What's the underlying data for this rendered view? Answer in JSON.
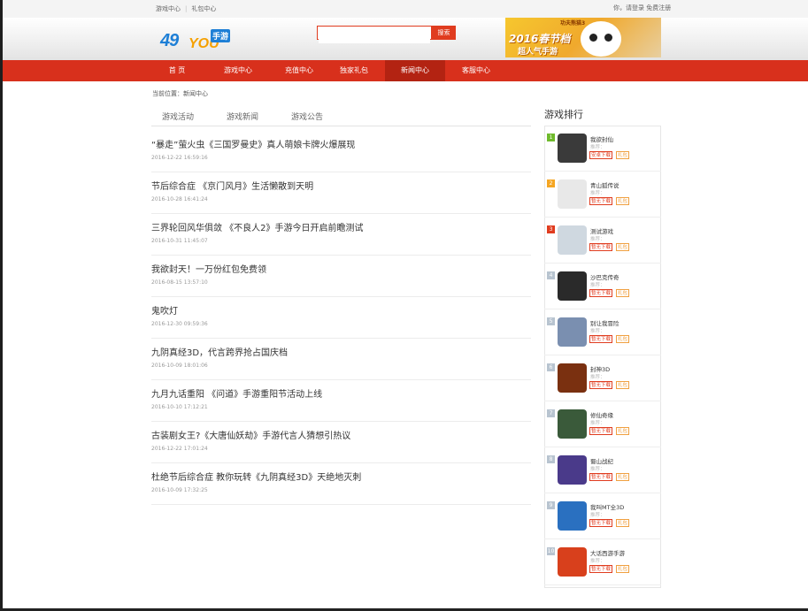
{
  "topbar": {
    "links": [
      "游戏中心",
      "礼包中心"
    ],
    "login_text": "你，请登录 免费注册"
  },
  "header": {
    "logo_num": "49",
    "logo_you": "YOU",
    "logo_tag": "手游",
    "search_placeholder": "",
    "search_button": "搜索",
    "banner_top": "功夫熊猫3",
    "banner_text": "2016春节档",
    "banner_sub": "超人气手游"
  },
  "nav": {
    "items": [
      "首 页",
      "游戏中心",
      "充值中心",
      "独家礼包",
      "新闻中心",
      "客服中心"
    ],
    "active_index": 4
  },
  "breadcrumb": "当前位置：新闻中心",
  "tabs": [
    "游戏活动",
    "游戏新闻",
    "游戏公告"
  ],
  "news": [
    {
      "title": "“暴走”萤火虫《三国罗曼史》真人萌娘卡牌火爆展现",
      "date": "2016-12-22 16:59:16"
    },
    {
      "title": "节后综合症 《京门风月》生活懒散到天明",
      "date": "2016-10-28 16:41:24"
    },
    {
      "title": "三界轮回风华俱敛 《不良人2》手游今日开启前瞻测试",
      "date": "2016-10-31 11:45:07"
    },
    {
      "title": "我欲封天！一万份红包免费领",
      "date": "2016-08-15 13:57:10"
    },
    {
      "title": "鬼吹灯",
      "date": "2016-12-30 09:59:36"
    },
    {
      "title": "九阴真经3D，代言跨界抢占国庆档",
      "date": "2016-10-09 18:01:06"
    },
    {
      "title": "九月九话重阳 《问道》手游重阳节活动上线",
      "date": "2016-10-10 17:12:21"
    },
    {
      "title": "古装剧女王?《大唐仙妖劫》手游代言人猜想引热议",
      "date": "2016-12-22 17:01:24"
    },
    {
      "title": "杜绝节后综合症 教你玩转《九阴真经3D》天绝地灭刺",
      "date": "2016-10-09 17:32:25"
    }
  ],
  "sidebar": {
    "title": "游戏排行",
    "rec_label": "推荐：",
    "gift_label": "礼包",
    "items": [
      {
        "rank": "1",
        "name": "我欲封仙",
        "download": "安卓下载",
        "rank_color": "#6fba2c",
        "icon_color": "#3a3a3a"
      },
      {
        "rank": "2",
        "name": "青山狐传说",
        "download": "暂无下载",
        "rank_color": "#f5a623",
        "icon_color": "#e8e8e8"
      },
      {
        "rank": "3",
        "name": "测试游戏",
        "download": "暂无下载",
        "rank_color": "#e03c1f",
        "icon_color": "#cfd8e0"
      },
      {
        "rank": "4",
        "name": "沙巴克传奇",
        "download": "暂无下载",
        "rank_color": "#b8c4d0",
        "icon_color": "#2a2a2a"
      },
      {
        "rank": "5",
        "name": "别让我冒险",
        "download": "暂无下载",
        "rank_color": "#b8c4d0",
        "icon_color": "#7a8fb0"
      },
      {
        "rank": "6",
        "name": "封神3D",
        "download": "暂无下载",
        "rank_color": "#b8c4d0",
        "icon_color": "#7a3010"
      },
      {
        "rank": "7",
        "name": "修仙奇缘",
        "download": "暂无下载",
        "rank_color": "#b8c4d0",
        "icon_color": "#3a5a3a"
      },
      {
        "rank": "8",
        "name": "蜀山战纪",
        "download": "暂无下载",
        "rank_color": "#b8c4d0",
        "icon_color": "#4a3a8a"
      },
      {
        "rank": "9",
        "name": "我叫MT全3D",
        "download": "暂无下载",
        "rank_color": "#b8c4d0",
        "icon_color": "#2a70c0"
      },
      {
        "rank": "10",
        "name": "大话西游手游",
        "download": "暂无下载",
        "rank_color": "#b8c4d0",
        "icon_color": "#d8401c"
      }
    ]
  }
}
